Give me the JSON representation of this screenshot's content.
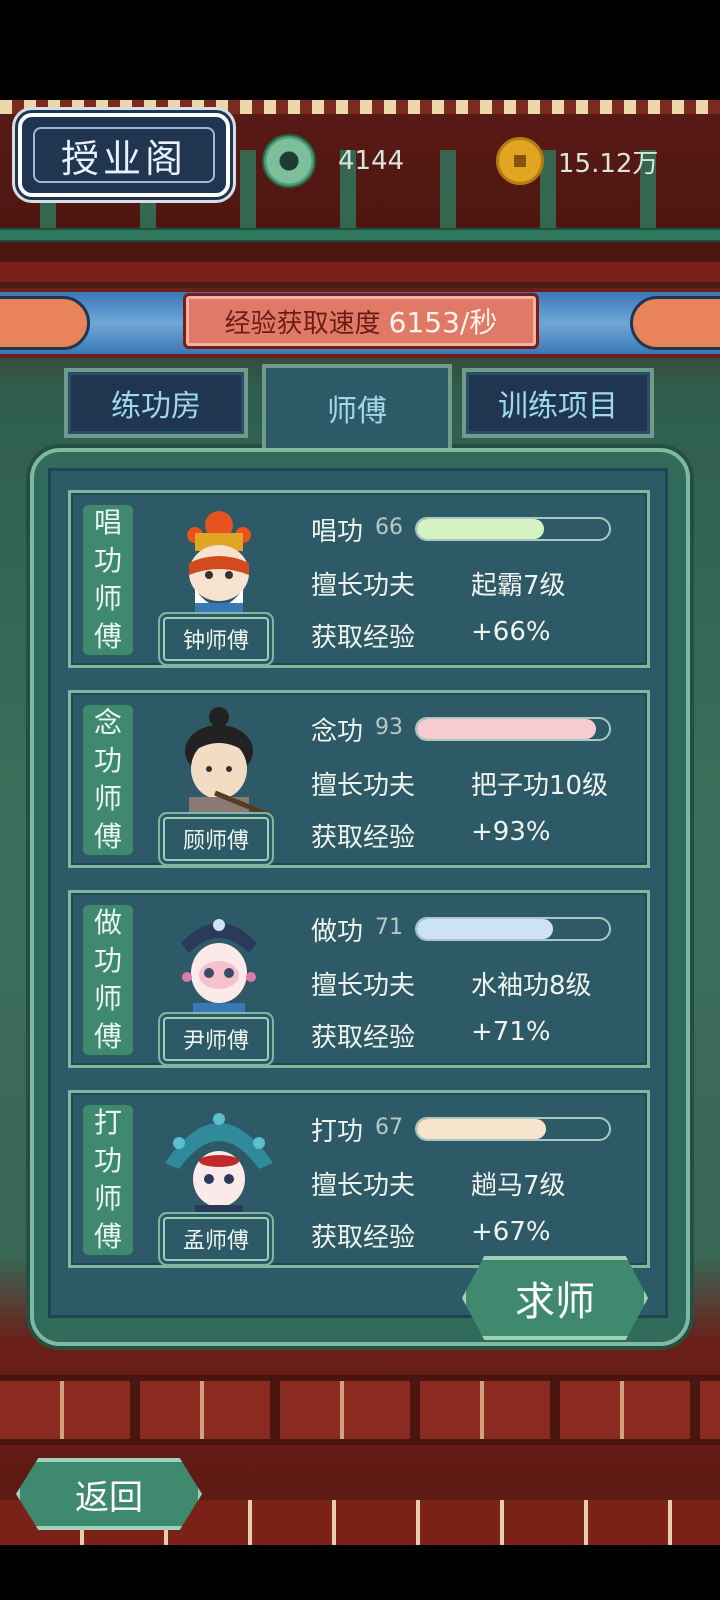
{
  "header": {
    "title": "授业阁",
    "jade_amount": "4144",
    "coin_amount": "15.12万"
  },
  "rate": {
    "label": "经验获取速度",
    "value": "6153/秒"
  },
  "tabs": [
    {
      "label": "练功房",
      "active": false
    },
    {
      "label": "师傅",
      "active": true
    },
    {
      "label": "训练项目",
      "active": false
    }
  ],
  "masters": [
    {
      "type_chars": [
        "唱",
        "功",
        "师",
        "傅"
      ],
      "name": "钟师傅",
      "skill": "唱功",
      "skill_value": "66",
      "progress": 0.66,
      "bar_color": "#d4f2c2",
      "specialty_label": "擅长功夫",
      "specialty": "起霸7级",
      "exp_label": "获取经验",
      "exp": "+66%"
    },
    {
      "type_chars": [
        "念",
        "功",
        "师",
        "傅"
      ],
      "name": "顾师傅",
      "skill": "念功",
      "skill_value": "93",
      "progress": 0.93,
      "bar_color": "#f6ccd0",
      "specialty_label": "擅长功夫",
      "specialty": "把子功10级",
      "exp_label": "获取经验",
      "exp": "+93%"
    },
    {
      "type_chars": [
        "做",
        "功",
        "师",
        "傅"
      ],
      "name": "尹师傅",
      "skill": "做功",
      "skill_value": "71",
      "progress": 0.71,
      "bar_color": "#cfe3f8",
      "specialty_label": "擅长功夫",
      "specialty": "水袖功8级",
      "exp_label": "获取经验",
      "exp": "+71%"
    },
    {
      "type_chars": [
        "打",
        "功",
        "师",
        "傅"
      ],
      "name": "孟师傅",
      "skill": "打功",
      "skill_value": "67",
      "progress": 0.67,
      "bar_color": "#f6e4cc",
      "specialty_label": "擅长功夫",
      "specialty": "趟马7级",
      "exp_label": "获取经验",
      "exp": "+67%"
    }
  ],
  "actions": {
    "seek_master": "求师",
    "back": "返回"
  },
  "icons": {
    "jade": "jade-disc-icon",
    "coin": "copper-coin-icon"
  }
}
